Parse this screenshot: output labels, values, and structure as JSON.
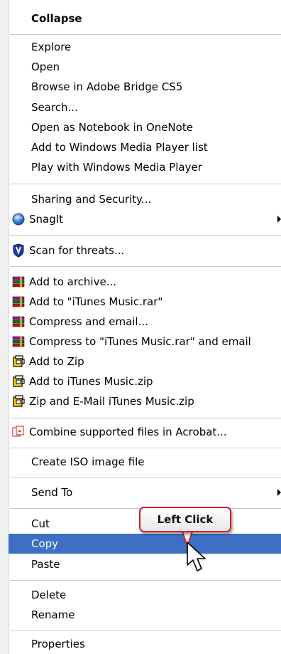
{
  "menu": {
    "collapse": "Collapse",
    "explore": "Explore",
    "open": "Open",
    "browse_bridge": "Browse in Adobe Bridge CS5",
    "search": "Search...",
    "onenote": "Open as Notebook in OneNote",
    "add_wmp_list": "Add to Windows Media Player list",
    "play_wmp": "Play with Windows Media Player",
    "sharing": "Sharing and Security...",
    "snagit": "SnagIt",
    "scan": "Scan for threats...",
    "add_archive": "Add to archive...",
    "add_rar": "Add to \"iTunes Music.rar\"",
    "compress_email": "Compress and email...",
    "compress_rar_email": "Compress to \"iTunes Music.rar\" and email",
    "add_zip": "Add to Zip",
    "add_itunes_zip": "Add to iTunes Music.zip",
    "zip_email": "Zip and E-Mail iTunes Music.zip",
    "acrobat": "Combine supported files in Acrobat...",
    "iso": "Create ISO image file",
    "send_to": "Send To",
    "cut": "Cut",
    "copy": "Copy",
    "paste": "Paste",
    "delete": "Delete",
    "rename": "Rename",
    "properties": "Properties"
  },
  "callout": {
    "text": "Left Click"
  },
  "colors": {
    "selection": "#3d6fc5",
    "callout_border": "#d51d2c"
  },
  "icons": {
    "snagit": "snagit-globe-icon",
    "scan": "shield-icon",
    "winrar": "winrar-books-icon",
    "winzip": "winzip-vise-icon",
    "acrobat": "acrobat-icon",
    "cursor": "mouse-pointer-icon"
  }
}
